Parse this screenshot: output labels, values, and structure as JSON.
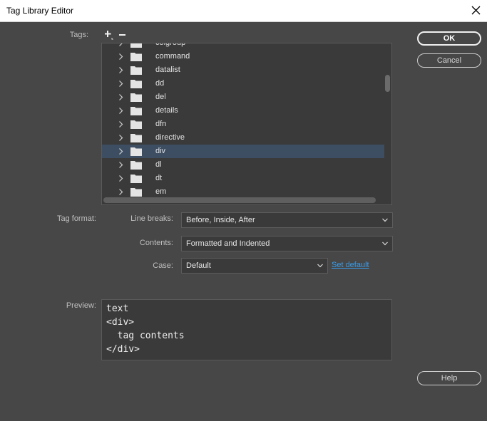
{
  "window": {
    "title": "Tag Library Editor"
  },
  "labels": {
    "tags": "Tags:",
    "tag_format": "Tag format:",
    "line_breaks": "Line breaks:",
    "contents": "Contents:",
    "case": "Case:",
    "preview": "Preview:"
  },
  "tree": {
    "items": [
      {
        "label": "colgroup",
        "selected": false
      },
      {
        "label": "command",
        "selected": false
      },
      {
        "label": "datalist",
        "selected": false
      },
      {
        "label": "dd",
        "selected": false
      },
      {
        "label": "del",
        "selected": false
      },
      {
        "label": "details",
        "selected": false
      },
      {
        "label": "dfn",
        "selected": false
      },
      {
        "label": "directive",
        "selected": false
      },
      {
        "label": "div",
        "selected": true
      },
      {
        "label": "dl",
        "selected": false
      },
      {
        "label": "dt",
        "selected": false
      },
      {
        "label": "em",
        "selected": false
      }
    ]
  },
  "format": {
    "line_breaks": "Before, Inside, After",
    "contents": "Formatted and Indented",
    "case": "Default",
    "set_default": "Set default"
  },
  "preview": {
    "lines": [
      "text",
      "<div>",
      "  tag contents",
      "</div>"
    ]
  },
  "buttons": {
    "ok": "OK",
    "cancel": "Cancel",
    "help": "Help"
  },
  "icons": {
    "add": "plus-icon",
    "remove": "minus-icon",
    "close": "close-icon",
    "expand": "chevron-right-icon",
    "folder": "folder-icon",
    "dropdown": "chevron-down-icon"
  }
}
